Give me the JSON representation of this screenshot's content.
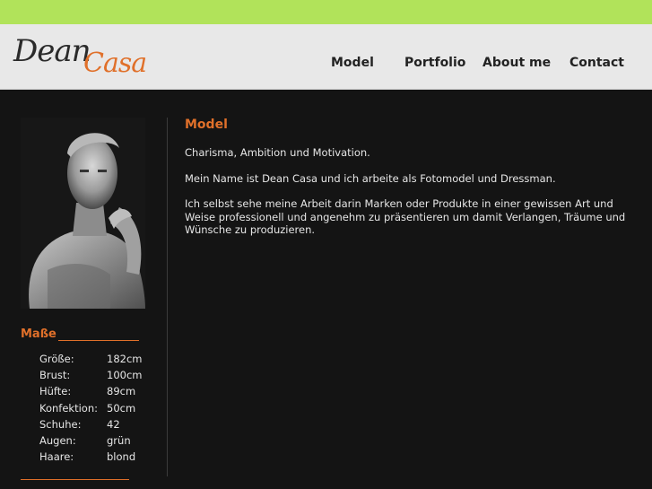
{
  "logo": {
    "first": "Dean",
    "second": "Casa"
  },
  "nav": [
    {
      "label": "Model"
    },
    {
      "label": "Portfolio"
    },
    {
      "label": "About me"
    },
    {
      "label": "Contact"
    }
  ],
  "sidebar": {
    "title": "Maße",
    "measures": [
      {
        "label": "Größe:",
        "value": "182cm"
      },
      {
        "label": "Brust:",
        "value": "100cm"
      },
      {
        "label": "Hüfte:",
        "value": "89cm"
      },
      {
        "label": "Konfektion:",
        "value": "50cm"
      },
      {
        "label": "Schuhe:",
        "value": "42"
      },
      {
        "label": "Augen:",
        "value": "grün"
      },
      {
        "label": "Haare:",
        "value": "blond"
      }
    ]
  },
  "content": {
    "title": "Model",
    "paragraphs": [
      "Charisma, Ambition und Motivation.",
      "Mein Name ist Dean Casa und ich arbeite als Fotomodel und Dressman.",
      "Ich selbst sehe meine Arbeit darin Marken oder Produkte in einer gewissen Art und Weise professionell und angenehm zu präsentieren um damit Verlangen, Träume und Wünsche zu produzieren."
    ]
  },
  "colors": {
    "accent_green": "#b1e35a",
    "accent_orange": "#e0702a",
    "background": "#141414",
    "header": "#e8e8e8"
  }
}
